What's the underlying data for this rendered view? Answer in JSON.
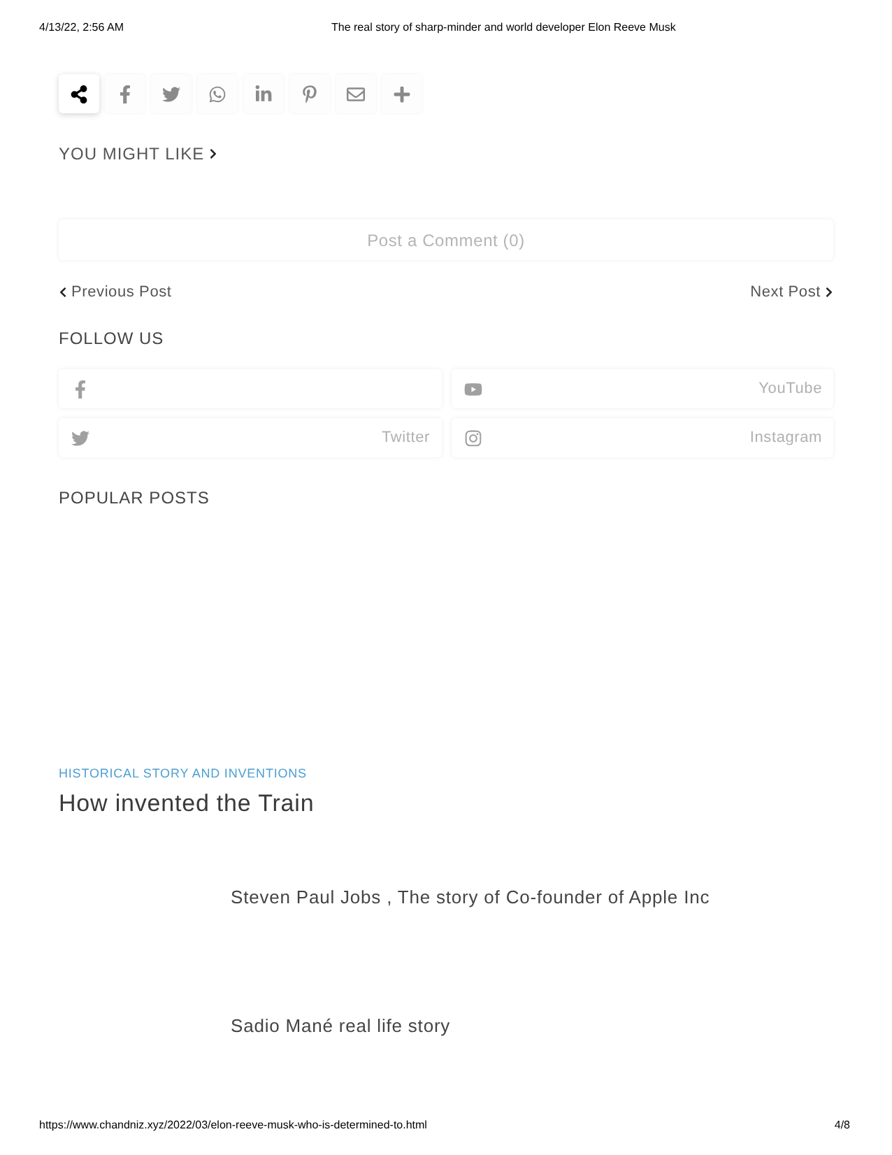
{
  "print_header": {
    "date": "4/13/22, 2:56 AM",
    "title": "The real story of sharp-minder and world developer Elon Reeve Musk"
  },
  "share_buttons": [
    {
      "kind": "share",
      "selected": true
    },
    {
      "kind": "facebook",
      "selected": false
    },
    {
      "kind": "twitter",
      "selected": false
    },
    {
      "kind": "whatsapp",
      "selected": false
    },
    {
      "kind": "linkedin",
      "selected": false
    },
    {
      "kind": "pinterest",
      "selected": false
    },
    {
      "kind": "email",
      "selected": false
    },
    {
      "kind": "more",
      "selected": false
    }
  ],
  "you_might_like": {
    "label": "YOU MIGHT LIKE"
  },
  "comments": {
    "label": "Post a Comment (0)"
  },
  "post_nav": {
    "previous": "Previous Post",
    "next": "Next Post"
  },
  "follow_us": {
    "title": "FOLLOW US",
    "links": [
      {
        "kind": "facebook"
      },
      {
        "kind": "youtube",
        "label": "YouTube"
      },
      {
        "kind": "twitter",
        "label": "Twitter"
      },
      {
        "kind": "instagram",
        "label": "Instagram"
      }
    ]
  },
  "popular_posts": {
    "title": "POPULAR POSTS",
    "featured": {
      "category": "HISTORICAL STORY AND INVENTIONS",
      "title": "How invented the Train"
    },
    "items": [
      {
        "title": "Steven Paul Jobs , The story of Co-founder of Apple Inc"
      },
      {
        "title": "Sadio Mané real life story"
      }
    ]
  },
  "print_footer": {
    "url": "https://www.chandniz.xyz/2022/03/elon-reeve-musk-who-is-determined-to.html",
    "page": "4/8"
  }
}
